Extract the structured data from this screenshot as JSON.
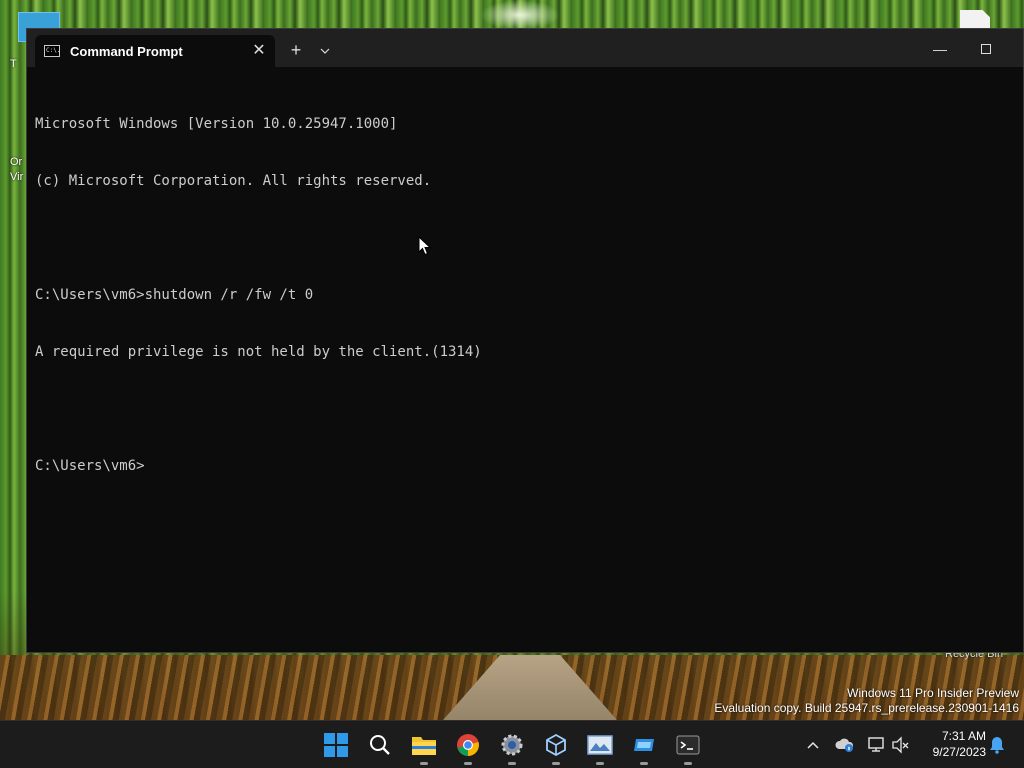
{
  "desktop": {
    "left_icon_labels": [
      "T",
      "Or",
      "Vir"
    ],
    "recycle_bin_label": "Recycle Bin",
    "watermark": {
      "line1": "Windows 11 Pro Insider Preview",
      "line2": "Evaluation copy. Build 25947.rs_prerelease.230901-1416"
    }
  },
  "window": {
    "tab_title": "Command Prompt",
    "tab_icon": "C:\\.",
    "close_tab_glyph": "✕",
    "new_tab_glyph": "+",
    "dropdown_glyph": "⌄",
    "minimize_glyph": "—"
  },
  "console": {
    "lines": [
      "Microsoft Windows [Version 10.0.25947.1000]",
      "(c) Microsoft Corporation. All rights reserved.",
      "",
      "C:\\Users\\vm6>shutdown /r /fw /t 0",
      "A required privilege is not held by the client.(1314)",
      "",
      "C:\\Users\\vm6>"
    ]
  },
  "taskbar": {
    "apps": [
      "start-icon",
      "search-icon",
      "file-explorer-icon",
      "chrome-icon",
      "settings-icon",
      "virtualbox-icon",
      "photos-icon",
      "remote-desktop-icon",
      "terminal-icon"
    ],
    "time": "7:31 AM",
    "date": "9/27/2023"
  },
  "colors": {
    "console_bg": "#0c0c0c",
    "console_text": "#cccccc",
    "titlebar_bg": "#202020",
    "taskbar_bg": "#1c1c1c",
    "accent": "#0078d4"
  }
}
